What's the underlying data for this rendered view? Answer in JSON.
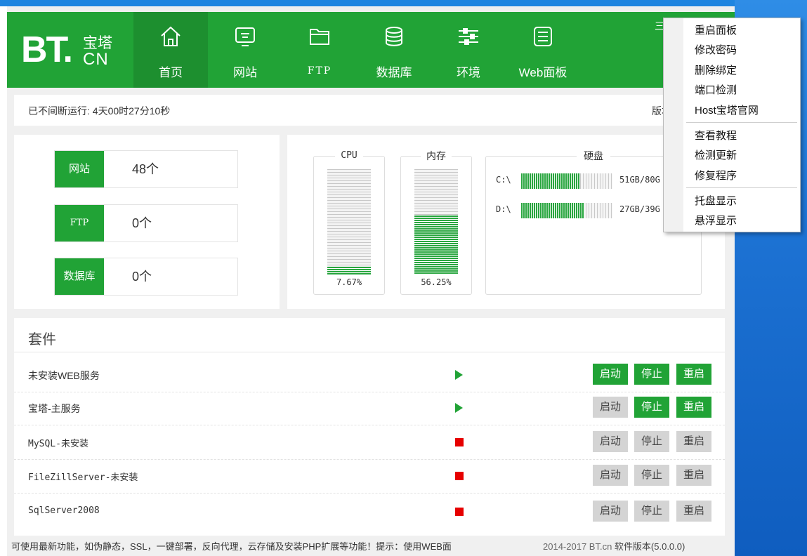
{
  "app": {
    "logo_main": "BT.",
    "logo_cn_top": "宝塔",
    "logo_cn_bottom": "CN"
  },
  "nav": [
    {
      "label": "首页",
      "icon": "home-icon"
    },
    {
      "label": "网站",
      "icon": "monitor-icon"
    },
    {
      "label": "FTP",
      "icon": "folder-icon"
    },
    {
      "label": "数据库",
      "icon": "database-icon"
    },
    {
      "label": "环境",
      "icon": "sliders-icon"
    },
    {
      "label": "Web面板",
      "icon": "list-icon"
    }
  ],
  "header_right_text": "三",
  "uptime": {
    "text": "已不间断运行: 4天00时27分10秒",
    "version_label": "版本"
  },
  "stats": [
    {
      "label": "网站",
      "value": "48个"
    },
    {
      "label": "FTP",
      "value": "0个"
    },
    {
      "label": "数据库",
      "value": "0个"
    }
  ],
  "monitor": {
    "cpu": {
      "title": "CPU",
      "percent_text": "7.67%",
      "percent": 7.67
    },
    "memory": {
      "title": "内存",
      "percent_text": "56.25%",
      "percent": 56.25
    },
    "disk": {
      "title": "硬盘",
      "drives": [
        {
          "name": "C:\\",
          "size": "51GB/80G",
          "used_fraction": 0.64
        },
        {
          "name": "D:\\",
          "size": "27GB/39G",
          "used_fraction": 0.69
        }
      ]
    }
  },
  "suite": {
    "title": "套件",
    "rows": [
      {
        "name": "未安装WEB服务",
        "status": "running",
        "start": "启动",
        "stop": "停止",
        "restart": "重启"
      },
      {
        "name": "宝塔-主服务",
        "status": "running",
        "start": "启动",
        "stop": "停止",
        "restart": "重启"
      },
      {
        "name": "MySQL-未安装",
        "status": "stopped",
        "start": "启动",
        "stop": "停止",
        "restart": "重启"
      },
      {
        "name": "FileZillServer-未安装",
        "status": "stopped",
        "start": "启动",
        "stop": "停止",
        "restart": "重启"
      },
      {
        "name": "SqlServer2008",
        "status": "stopped",
        "start": "启动",
        "stop": "停止",
        "restart": "重启"
      }
    ]
  },
  "footer": {
    "tip": "可使用最新功能，如伪静态，SSL，一键部署，反向代理，云存储及安装PHP扩展等功能！提示：使用WEB面",
    "copyright": "2014-2017 BT.cn",
    "version": "软件版本(5.0.0.0)"
  },
  "context_menu": {
    "group1": [
      "重启面板",
      "修改密码",
      "删除绑定",
      "端口检测",
      "Host宝塔官网"
    ],
    "group2": [
      "查看教程",
      "检测更新",
      "修复程序"
    ],
    "group3": [
      "托盘显示",
      "悬浮显示"
    ]
  },
  "colors": {
    "brand_green": "#21a336",
    "stop_red": "#e60000",
    "disabled_gray": "#d4d4d4",
    "desktop_blue": "#1d73d4"
  }
}
